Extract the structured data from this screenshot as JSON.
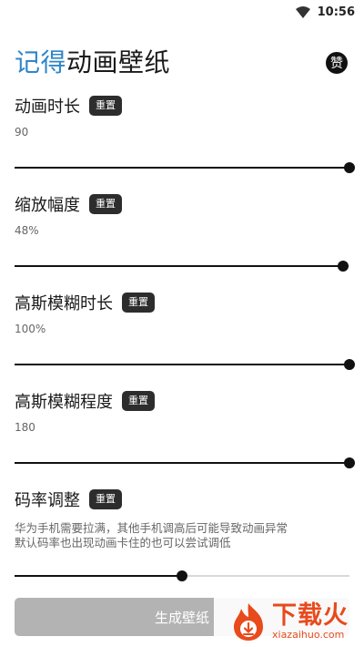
{
  "status_bar": {
    "time": "10:56"
  },
  "header": {
    "title_accent": "记得",
    "title_rest": "动画壁纸",
    "like_label": "赞"
  },
  "settings": [
    {
      "label": "动画时长",
      "reset_label": "重置",
      "value": "90",
      "level": 1.0
    },
    {
      "label": "缩放幅度",
      "reset_label": "重置",
      "value": "48%",
      "level": 0.98
    },
    {
      "label": "高斯模糊时长",
      "reset_label": "重置",
      "value": "100%",
      "level": 1.0
    },
    {
      "label": "高斯模糊程度",
      "reset_label": "重置",
      "value": "180",
      "level": 1.0
    },
    {
      "label": "码率调整",
      "reset_label": "重置",
      "description_line1": "华为手机需要拉满，其他手机调高后可能导致动画异常",
      "description_line2": "默认码率也出现动画卡住的也可以尝试调低",
      "level": 0.5
    }
  ],
  "generate_button": {
    "label": "生成壁纸"
  },
  "watermark": {
    "name": "下载火",
    "url": "xiazaihuo.com"
  },
  "colors": {
    "accent": "#2f86c9",
    "slider_active": "#111111",
    "slider_inactive": "#d9d9d9",
    "button_bg": "#b3b3b3",
    "watermark": "#e84a1c"
  }
}
